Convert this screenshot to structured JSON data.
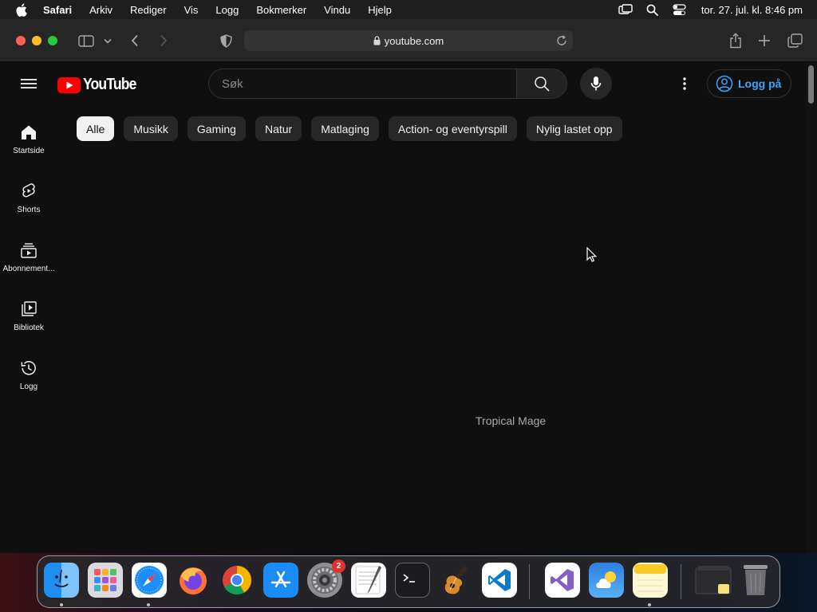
{
  "menubar": {
    "apple_icon": "apple-icon",
    "items": [
      "Safari",
      "Arkiv",
      "Rediger",
      "Vis",
      "Logg",
      "Bokmerker",
      "Vindu",
      "Hjelp"
    ],
    "status_icons": [
      "screen-mirroring-icon",
      "spotlight-search-icon",
      "control-center-icon"
    ],
    "clock": "tor. 27. jul. kl. 8:46 pm"
  },
  "browser": {
    "address": "youtube.com",
    "icons": [
      "sidebar-toggle-icon",
      "chevron-down-icon",
      "back-icon",
      "forward-icon",
      "privacy-shield-icon",
      "lock-icon",
      "reload-icon",
      "share-icon",
      "new-tab-icon",
      "tab-overview-icon"
    ]
  },
  "youtube": {
    "logo_text": "YouTube",
    "search_placeholder": "Søk",
    "login_label": "Logg på",
    "chips": [
      "Alle",
      "Musikk",
      "Gaming",
      "Natur",
      "Matlaging",
      "Action- og eventyrspill",
      "Nylig lastet opp"
    ],
    "active_chip": "Alle",
    "nav": [
      {
        "label": "Startside",
        "icon": "home-icon"
      },
      {
        "label": "Shorts",
        "icon": "shorts-icon"
      },
      {
        "label": "Abonnement...",
        "icon": "subscriptions-icon"
      },
      {
        "label": "Bibliotek",
        "icon": "library-icon"
      },
      {
        "label": "Logg",
        "icon": "history-icon"
      }
    ],
    "content_text": "Tropical Mage"
  },
  "dock": {
    "apps": [
      "finder",
      "launchpad",
      "safari",
      "firefox",
      "chrome",
      "app-store",
      "system-settings",
      "textedit",
      "terminal",
      "garageband",
      "vscode",
      "visual-studio",
      "weather",
      "notes",
      "downloads-stack",
      "trash"
    ],
    "system_settings_badge": "2"
  },
  "colors": {
    "brand_red": "#ff0000",
    "link_blue": "#3ea6ff",
    "background": "#0f0f0f"
  }
}
